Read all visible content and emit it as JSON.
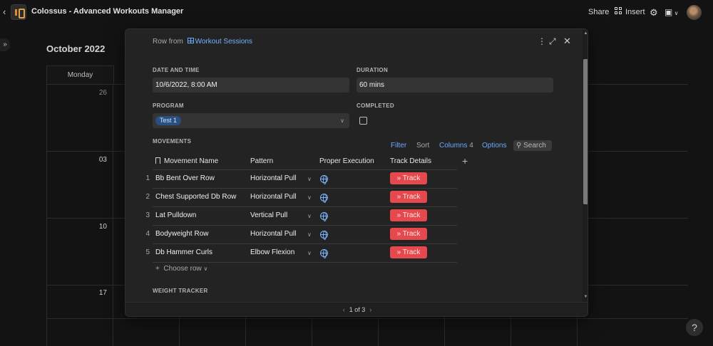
{
  "app": {
    "title": "Colossus - Advanced Workouts Manager",
    "share_label": "Share",
    "insert_label": "Insert",
    "icons": [
      "chevron-left-icon",
      "doc-icon",
      "grid-icon",
      "gear-icon",
      "layout-icon",
      "chevron-down-icon",
      "avatar"
    ]
  },
  "calendar": {
    "month": "October 2022",
    "day_header": "Monday",
    "day_numbers": [
      "26",
      "03",
      "10",
      "17"
    ]
  },
  "modal": {
    "source_prefix": "Row from",
    "source_table": "Workout Sessions",
    "fields": {
      "date_label": "DATE AND TIME",
      "date_value": "10/6/2022, 8:00 AM",
      "duration_label": "DURATION",
      "duration_value": "60 mins",
      "program_label": "PROGRAM",
      "program_value": "Test 1",
      "completed_label": "COMPLETED",
      "completed_value": false
    },
    "movements": {
      "label": "MOVEMENTS",
      "toolbar": {
        "filter": "Filter",
        "sort": "Sort",
        "columns": "Columns",
        "columns_count": "4",
        "options": "Options",
        "search": "Search"
      },
      "columns": [
        "Movement Name",
        "Pattern",
        "Proper Execution",
        "Track Details"
      ],
      "rows": [
        {
          "num": "1",
          "name": "Bb Bent Over Row",
          "pattern": "Horizontal Pull",
          "track": "Track"
        },
        {
          "num": "2",
          "name": "Chest Supported Db Row",
          "pattern": "Horizontal Pull",
          "track": "Track"
        },
        {
          "num": "3",
          "name": "Lat Pulldown",
          "pattern": "Vertical Pull",
          "track": "Track"
        },
        {
          "num": "4",
          "name": "Bodyweight Row",
          "pattern": "Horizontal Pull",
          "track": "Track"
        },
        {
          "num": "5",
          "name": "Db Hammer Curls",
          "pattern": "Elbow Flexion",
          "track": "Track"
        }
      ],
      "choose_row": "Choose row"
    },
    "weight_label": "WEIGHT TRACKER",
    "pager": "1 of 3"
  },
  "colors": {
    "accent_blue": "#6ba9ff",
    "track_red": "#e5484d",
    "chip_blue": "#2a4f82"
  }
}
